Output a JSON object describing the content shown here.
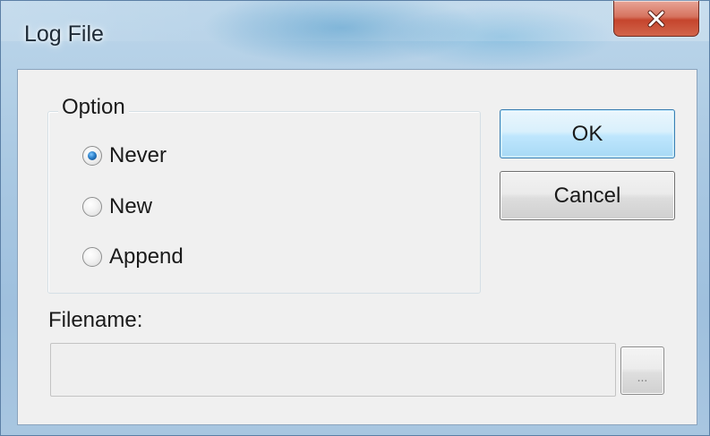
{
  "window": {
    "title": "Log File"
  },
  "option_group": {
    "legend": "Option",
    "options": [
      {
        "label": "Never",
        "checked": true
      },
      {
        "label": "New",
        "checked": false
      },
      {
        "label": "Append",
        "checked": false
      }
    ]
  },
  "buttons": {
    "ok_label": "OK",
    "cancel_label": "Cancel",
    "browse_label": "..."
  },
  "filename": {
    "label": "Filename:",
    "value": "",
    "placeholder": ""
  },
  "colors": {
    "close_button": "#c5452d",
    "ok_button_border": "#3c7fb1",
    "radio_checked": "#2a7fc9",
    "client_background": "#f0f0f0"
  },
  "icons": {
    "close": "close-icon",
    "radio_checked": "radio-checked-icon",
    "radio_unchecked": "radio-unchecked-icon"
  }
}
